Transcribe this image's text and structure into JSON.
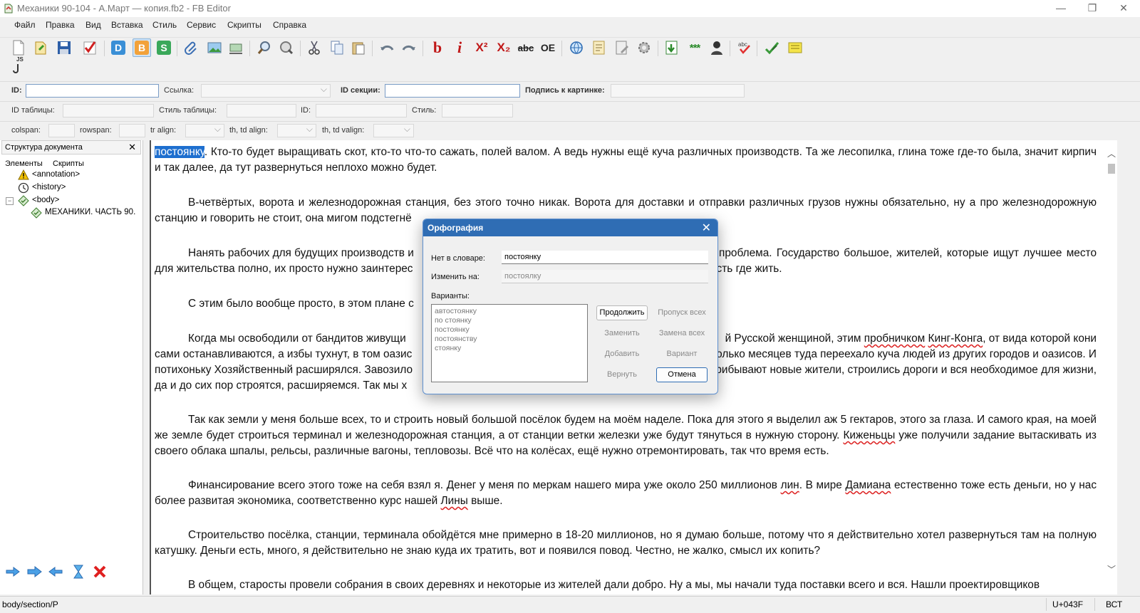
{
  "window": {
    "title": "Механики 90-104 - А.Март — копия.fb2 - FB Editor",
    "minimize_glyph": "—",
    "maximize_glyph": "❐",
    "close_glyph": "✕"
  },
  "menu": [
    "Файл",
    "Правка",
    "Вид",
    "Вставка",
    "Стиль",
    "Сервис",
    "Скрипты",
    "Справка"
  ],
  "toolbar": {
    "bold_label": "b",
    "italic_label": "i",
    "superscript_label": "X²",
    "subscript_label": "X₂",
    "strike_label": "abc",
    "code_label": "OE",
    "stars_label": "***",
    "js_label": "JS",
    "doc_d": "D",
    "doc_b": "B",
    "doc_s": "S"
  },
  "fields_row1": {
    "id_label": "ID:",
    "link_label": "Ссылка:",
    "section_id_label": "ID секции:",
    "caption_label": "Подпись к картинке:"
  },
  "fields_row2": {
    "table_id_label": "ID таблицы:",
    "table_style_label": "Стиль таблицы:",
    "id_label": "ID:",
    "style_label": "Стиль:"
  },
  "fields_row3": {
    "colspan_label": "colspan:",
    "rowspan_label": "rowspan:",
    "tr_align_label": "tr align:",
    "td_align_label": "th, td align:",
    "td_valign_label": "th, td valign:"
  },
  "sidebar": {
    "title": "Структура документа",
    "tabs": [
      "Элементы",
      "Скрипты"
    ],
    "tree": [
      {
        "label": "<annotation>",
        "icon": "warning-icon"
      },
      {
        "label": "<history>",
        "icon": "history-icon"
      },
      {
        "label": "<body>",
        "icon": "body-icon"
      },
      {
        "label": "МЕХАНИКИ. ЧАСТЬ 90.",
        "icon": "section-icon"
      }
    ],
    "bottom_buttons": [
      "arrow-right-icon",
      "arrow-right-bold-icon",
      "arrow-left-icon",
      "hourglass-icon",
      "delete-icon"
    ]
  },
  "document": {
    "p1": {
      "hl": "постоянку",
      "t1": ". Кто-то будет выращивать скот, кто-то что-то сажать, полей валом. А ведь нужны ещё куча различных производств. Та же лесопилка, глина тоже где-то была, значит кирпич и так далее, да тут развернуться неплохо можно будет."
    },
    "p2": "В-четвёртых, ворота и железнодорожная станция, без этого точно никак. Ворота для доставки и отправки различных грузов нужны обязательно, ну а про железнодорожную станцию и говорить не стоит, она мигом подстегнё",
    "p3": {
      "a": "Нанять рабочих для будущих производств и",
      "b": "е проблема. Государство большое, жителей, которые ищут лучшее место",
      "c": "для жительства полно, их просто нужно заинтерес",
      "d": "есть где жить."
    },
    "p4": {
      "a": "С этим было вообще просто, в этом плане с",
      "b": "с."
    },
    "p5": {
      "a": "Когда мы освободили от бандитов живущи",
      "b": "й Русской женщиной, этим ",
      "s1": "пробничком",
      "c": " ",
      "s2": "Кинг-Конга",
      "d": ", от вида которой кони",
      "e": "сами останавливаются, а избы тухнут, в том оазис",
      "f": "олько месяцев туда переехало куча людей из других городов и оазисов. И",
      "g": "потихоньку Хозяйственный расширялся. Завозило",
      "h": "рибывают новые жители, строились дороги и вся необходимое для жизни,",
      "i": "да и до сих пор строятся, расширяемся. Так мы х"
    },
    "p6": {
      "a": "Так как земли у меня больше всех, то и строить новый большой посёлок будем на моём наделе. Пока для этого я выделил аж 5 гектаров, этого за глаза. И самого края, на моей же земле будет строиться терминал и железнодорожная станция, а от станции ветки железки уже будут тянуться в нужную сторону. ",
      "s1": "Киженьцы",
      "b": " уже получили задание вытаскивать из своего облака шпалы, рельсы, различные вагоны, тепловозы. Всё что на колёсах, ещё нужно отремонтировать, так что время есть."
    },
    "p7": {
      "a": "Финансирование всего этого тоже на себя взял я. Денег у меня по меркам нашего мира уже около 250 миллионов ",
      "s1": "лин",
      "b": ". В мире ",
      "s2": "Дамиана",
      "c": " естественно тоже есть деньги, но у нас более развитая экономика, соответственно курс нашей ",
      "s3": "Лины",
      "d": " выше."
    },
    "p8": "Строительство посёлка, станции, терминала обойдётся мне примерно в 18-20 миллионов, но я думаю больше, потому что я действительно хотел развернуться там на полную катушку. Деньги есть, много, я действительно не знаю куда их тратить, вот и появился повод. Честно, не жалко, смысл их копить?",
    "p9": "В общем, старосты провели собрания в своих деревнях и некоторые из жителей дали добро. Ну а мы, мы начали туда поставки всего и вся. Нашли проектировщиков"
  },
  "status": {
    "path": "body/section/P",
    "char": "U+043F",
    "mode": "ВСТ"
  },
  "dialog": {
    "title": "Орфография",
    "not_in_dict_label": "Нет в словаре:",
    "not_in_dict_value": "постоянку",
    "change_to_label": "Изменить на:",
    "change_to_value": "постоялку",
    "variants_label": "Варианты:",
    "variants": [
      "автостоянку",
      "по стоянку",
      "постоянку",
      "постоянству",
      "стоянку"
    ],
    "buttons": {
      "continue": "Продолжить",
      "skip_all": "Пропуск всех",
      "replace": "Заменить",
      "replace_all": "Замена всех",
      "add": "Добавить",
      "variant": "Вариант",
      "undo": "Вернуть",
      "cancel": "Отмена"
    }
  }
}
